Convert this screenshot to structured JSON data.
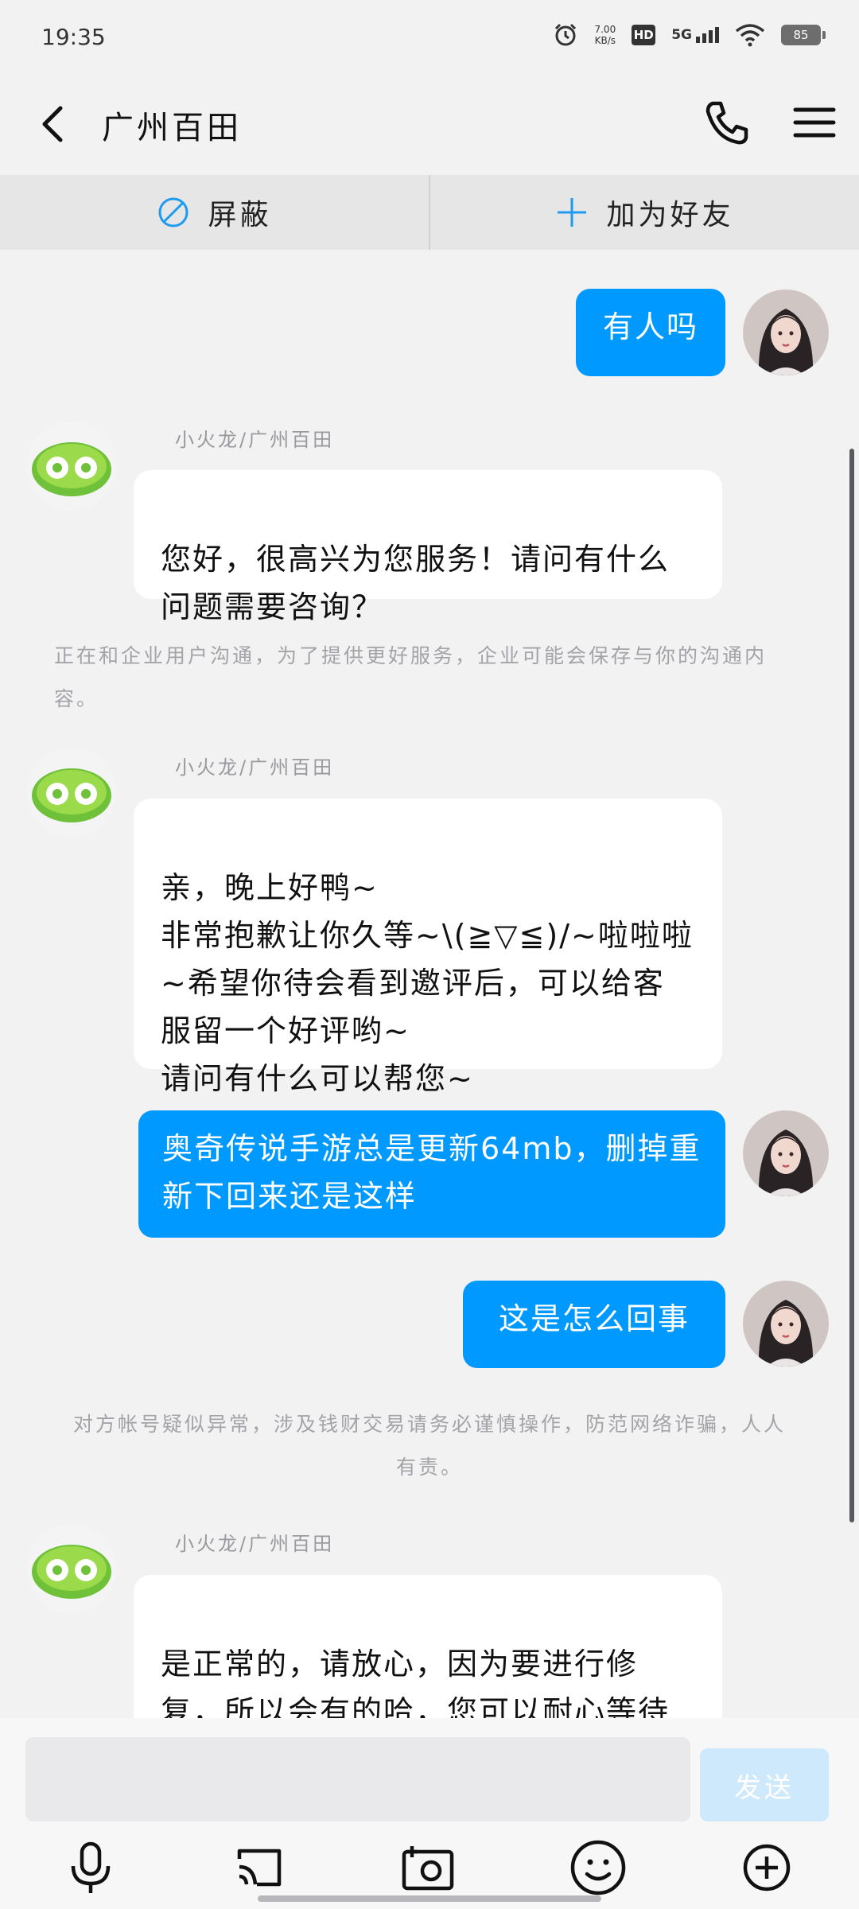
{
  "status_bar": {
    "time": "19:35",
    "net_speed_value": "7.00",
    "net_speed_unit": "KB/s",
    "hd_label": "HD",
    "network": "5G",
    "battery": "85"
  },
  "header": {
    "title": "广州百田",
    "back_icon": "chevron-left-icon",
    "call_icon": "phone-icon",
    "menu_icon": "hamburger-menu-icon"
  },
  "actions": {
    "block_label": "屏蔽",
    "add_friend_label": "加为好友"
  },
  "messages": [
    {
      "side": "right",
      "text": "有人吗"
    },
    {
      "side": "left",
      "sender": "小火龙/广州百田",
      "text": "您好，很高兴为您服务！请问有什么问题需要咨询？"
    },
    {
      "side": "left",
      "sender": "小火龙/广州百田",
      "text": "亲，晚上好鸭~\n非常抱歉让你久等~\\(≧▽≦)/~啦啦啦~希望你待会看到邀评后，可以给客服留一个好评哟~\n请问有什么可以帮您~"
    },
    {
      "side": "right",
      "text": "奥奇传说手游总是更新64mb，删掉重新下回来还是这样"
    },
    {
      "side": "right",
      "text": "这是怎么回事"
    },
    {
      "side": "left",
      "sender": "小火龙/广州百田",
      "text": "是正常的，请放心，因为要进行修复，所以会有的哈，您可以耐心等待后续大大的优化哦"
    }
  ],
  "notices": [
    "正在和企业用户沟通，为了提供更好服务，企业可能会保存与你的沟通内容。",
    "对方帐号疑似异常，涉及钱财交易请务必谨慎操作，防范网络诈骗，人人有责。"
  ],
  "input": {
    "placeholder": "",
    "send_label": "发送"
  },
  "toolbar": {
    "icons": [
      "microphone-icon",
      "screen-cast-icon",
      "camera-icon",
      "emoji-icon",
      "plus-circle-icon"
    ]
  },
  "colors": {
    "accent": "#0099ff",
    "background": "#f2f2f3"
  }
}
